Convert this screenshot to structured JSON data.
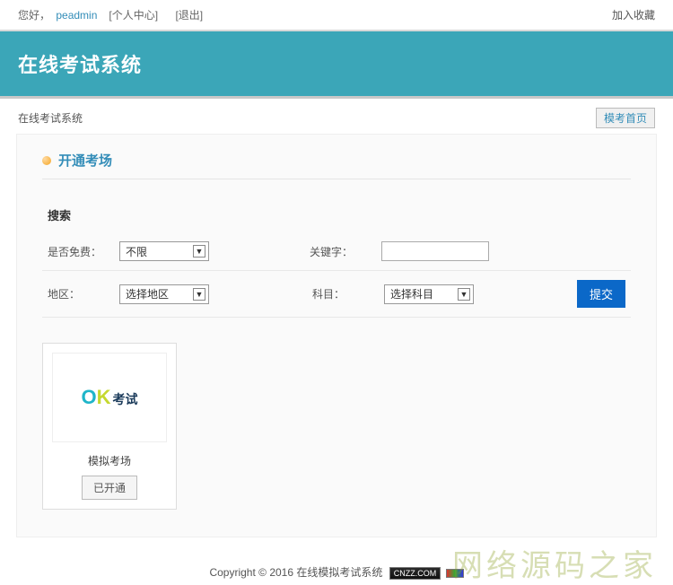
{
  "topbar": {
    "greeting": "您好，",
    "username": "peadmin",
    "personal_center": "[个人中心]",
    "logout": "[退出]",
    "favorite": "加入收藏"
  },
  "header": {
    "title": "在线考试系统"
  },
  "breadcrumb": {
    "text": "在线考试系统",
    "button": "模考首页"
  },
  "panel": {
    "title": "开通考场",
    "search_label": "搜索",
    "free_label": "是否免费：",
    "free_value": "不限",
    "keyword_label": "关键字：",
    "keyword_value": "",
    "region_label": "地区：",
    "region_value": "选择地区",
    "subject_label": "科目：",
    "subject_value": "选择科目",
    "submit": "提交"
  },
  "card": {
    "logo_ok_o": "O",
    "logo_ok_k": "K",
    "logo_cn": "考试",
    "name": "模拟考场",
    "status": "已开通"
  },
  "footer": {
    "copyright": "Copyright © 2016 在线模拟考试系统",
    "badge": "CNZZ.COM",
    "watermark": "网络源码之家"
  }
}
